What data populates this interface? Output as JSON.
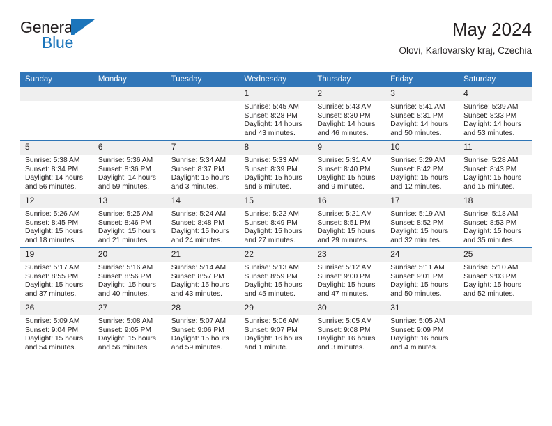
{
  "brand": {
    "name_top": "General",
    "name_bottom": "Blue",
    "logo_color": "#1b75bb",
    "text_color": "#231f20"
  },
  "header": {
    "title": "May 2024",
    "subtitle": "Olovi, Karlovarsky kraj, Czechia"
  },
  "theme": {
    "header_blue": "#3176b8",
    "rule_blue": "#2e75b6",
    "daynum_bg": "#efefef",
    "page_bg": "#ffffff"
  },
  "weekday_headers": [
    "Sunday",
    "Monday",
    "Tuesday",
    "Wednesday",
    "Thursday",
    "Friday",
    "Saturday"
  ],
  "labels": {
    "sunrise": "Sunrise:",
    "sunset": "Sunset:",
    "daylight": "Daylight:"
  },
  "weeks": [
    [
      {
        "day": "",
        "blank": true
      },
      {
        "day": "",
        "blank": true
      },
      {
        "day": "",
        "blank": true
      },
      {
        "day": "1",
        "sunrise": "Sunrise: 5:45 AM",
        "sunset": "Sunset: 8:28 PM",
        "daylight": "Daylight: 14 hours and 43 minutes."
      },
      {
        "day": "2",
        "sunrise": "Sunrise: 5:43 AM",
        "sunset": "Sunset: 8:30 PM",
        "daylight": "Daylight: 14 hours and 46 minutes."
      },
      {
        "day": "3",
        "sunrise": "Sunrise: 5:41 AM",
        "sunset": "Sunset: 8:31 PM",
        "daylight": "Daylight: 14 hours and 50 minutes."
      },
      {
        "day": "4",
        "sunrise": "Sunrise: 5:39 AM",
        "sunset": "Sunset: 8:33 PM",
        "daylight": "Daylight: 14 hours and 53 minutes."
      }
    ],
    [
      {
        "day": "5",
        "sunrise": "Sunrise: 5:38 AM",
        "sunset": "Sunset: 8:34 PM",
        "daylight": "Daylight: 14 hours and 56 minutes."
      },
      {
        "day": "6",
        "sunrise": "Sunrise: 5:36 AM",
        "sunset": "Sunset: 8:36 PM",
        "daylight": "Daylight: 14 hours and 59 minutes."
      },
      {
        "day": "7",
        "sunrise": "Sunrise: 5:34 AM",
        "sunset": "Sunset: 8:37 PM",
        "daylight": "Daylight: 15 hours and 3 minutes."
      },
      {
        "day": "8",
        "sunrise": "Sunrise: 5:33 AM",
        "sunset": "Sunset: 8:39 PM",
        "daylight": "Daylight: 15 hours and 6 minutes."
      },
      {
        "day": "9",
        "sunrise": "Sunrise: 5:31 AM",
        "sunset": "Sunset: 8:40 PM",
        "daylight": "Daylight: 15 hours and 9 minutes."
      },
      {
        "day": "10",
        "sunrise": "Sunrise: 5:29 AM",
        "sunset": "Sunset: 8:42 PM",
        "daylight": "Daylight: 15 hours and 12 minutes."
      },
      {
        "day": "11",
        "sunrise": "Sunrise: 5:28 AM",
        "sunset": "Sunset: 8:43 PM",
        "daylight": "Daylight: 15 hours and 15 minutes."
      }
    ],
    [
      {
        "day": "12",
        "sunrise": "Sunrise: 5:26 AM",
        "sunset": "Sunset: 8:45 PM",
        "daylight": "Daylight: 15 hours and 18 minutes."
      },
      {
        "day": "13",
        "sunrise": "Sunrise: 5:25 AM",
        "sunset": "Sunset: 8:46 PM",
        "daylight": "Daylight: 15 hours and 21 minutes."
      },
      {
        "day": "14",
        "sunrise": "Sunrise: 5:24 AM",
        "sunset": "Sunset: 8:48 PM",
        "daylight": "Daylight: 15 hours and 24 minutes."
      },
      {
        "day": "15",
        "sunrise": "Sunrise: 5:22 AM",
        "sunset": "Sunset: 8:49 PM",
        "daylight": "Daylight: 15 hours and 27 minutes."
      },
      {
        "day": "16",
        "sunrise": "Sunrise: 5:21 AM",
        "sunset": "Sunset: 8:51 PM",
        "daylight": "Daylight: 15 hours and 29 minutes."
      },
      {
        "day": "17",
        "sunrise": "Sunrise: 5:19 AM",
        "sunset": "Sunset: 8:52 PM",
        "daylight": "Daylight: 15 hours and 32 minutes."
      },
      {
        "day": "18",
        "sunrise": "Sunrise: 5:18 AM",
        "sunset": "Sunset: 8:53 PM",
        "daylight": "Daylight: 15 hours and 35 minutes."
      }
    ],
    [
      {
        "day": "19",
        "sunrise": "Sunrise: 5:17 AM",
        "sunset": "Sunset: 8:55 PM",
        "daylight": "Daylight: 15 hours and 37 minutes."
      },
      {
        "day": "20",
        "sunrise": "Sunrise: 5:16 AM",
        "sunset": "Sunset: 8:56 PM",
        "daylight": "Daylight: 15 hours and 40 minutes."
      },
      {
        "day": "21",
        "sunrise": "Sunrise: 5:14 AM",
        "sunset": "Sunset: 8:57 PM",
        "daylight": "Daylight: 15 hours and 43 minutes."
      },
      {
        "day": "22",
        "sunrise": "Sunrise: 5:13 AM",
        "sunset": "Sunset: 8:59 PM",
        "daylight": "Daylight: 15 hours and 45 minutes."
      },
      {
        "day": "23",
        "sunrise": "Sunrise: 5:12 AM",
        "sunset": "Sunset: 9:00 PM",
        "daylight": "Daylight: 15 hours and 47 minutes."
      },
      {
        "day": "24",
        "sunrise": "Sunrise: 5:11 AM",
        "sunset": "Sunset: 9:01 PM",
        "daylight": "Daylight: 15 hours and 50 minutes."
      },
      {
        "day": "25",
        "sunrise": "Sunrise: 5:10 AM",
        "sunset": "Sunset: 9:03 PM",
        "daylight": "Daylight: 15 hours and 52 minutes."
      }
    ],
    [
      {
        "day": "26",
        "sunrise": "Sunrise: 5:09 AM",
        "sunset": "Sunset: 9:04 PM",
        "daylight": "Daylight: 15 hours and 54 minutes."
      },
      {
        "day": "27",
        "sunrise": "Sunrise: 5:08 AM",
        "sunset": "Sunset: 9:05 PM",
        "daylight": "Daylight: 15 hours and 56 minutes."
      },
      {
        "day": "28",
        "sunrise": "Sunrise: 5:07 AM",
        "sunset": "Sunset: 9:06 PM",
        "daylight": "Daylight: 15 hours and 59 minutes."
      },
      {
        "day": "29",
        "sunrise": "Sunrise: 5:06 AM",
        "sunset": "Sunset: 9:07 PM",
        "daylight": "Daylight: 16 hours and 1 minute."
      },
      {
        "day": "30",
        "sunrise": "Sunrise: 5:05 AM",
        "sunset": "Sunset: 9:08 PM",
        "daylight": "Daylight: 16 hours and 3 minutes."
      },
      {
        "day": "31",
        "sunrise": "Sunrise: 5:05 AM",
        "sunset": "Sunset: 9:09 PM",
        "daylight": "Daylight: 16 hours and 4 minutes."
      },
      {
        "day": "",
        "blank": true
      }
    ]
  ]
}
